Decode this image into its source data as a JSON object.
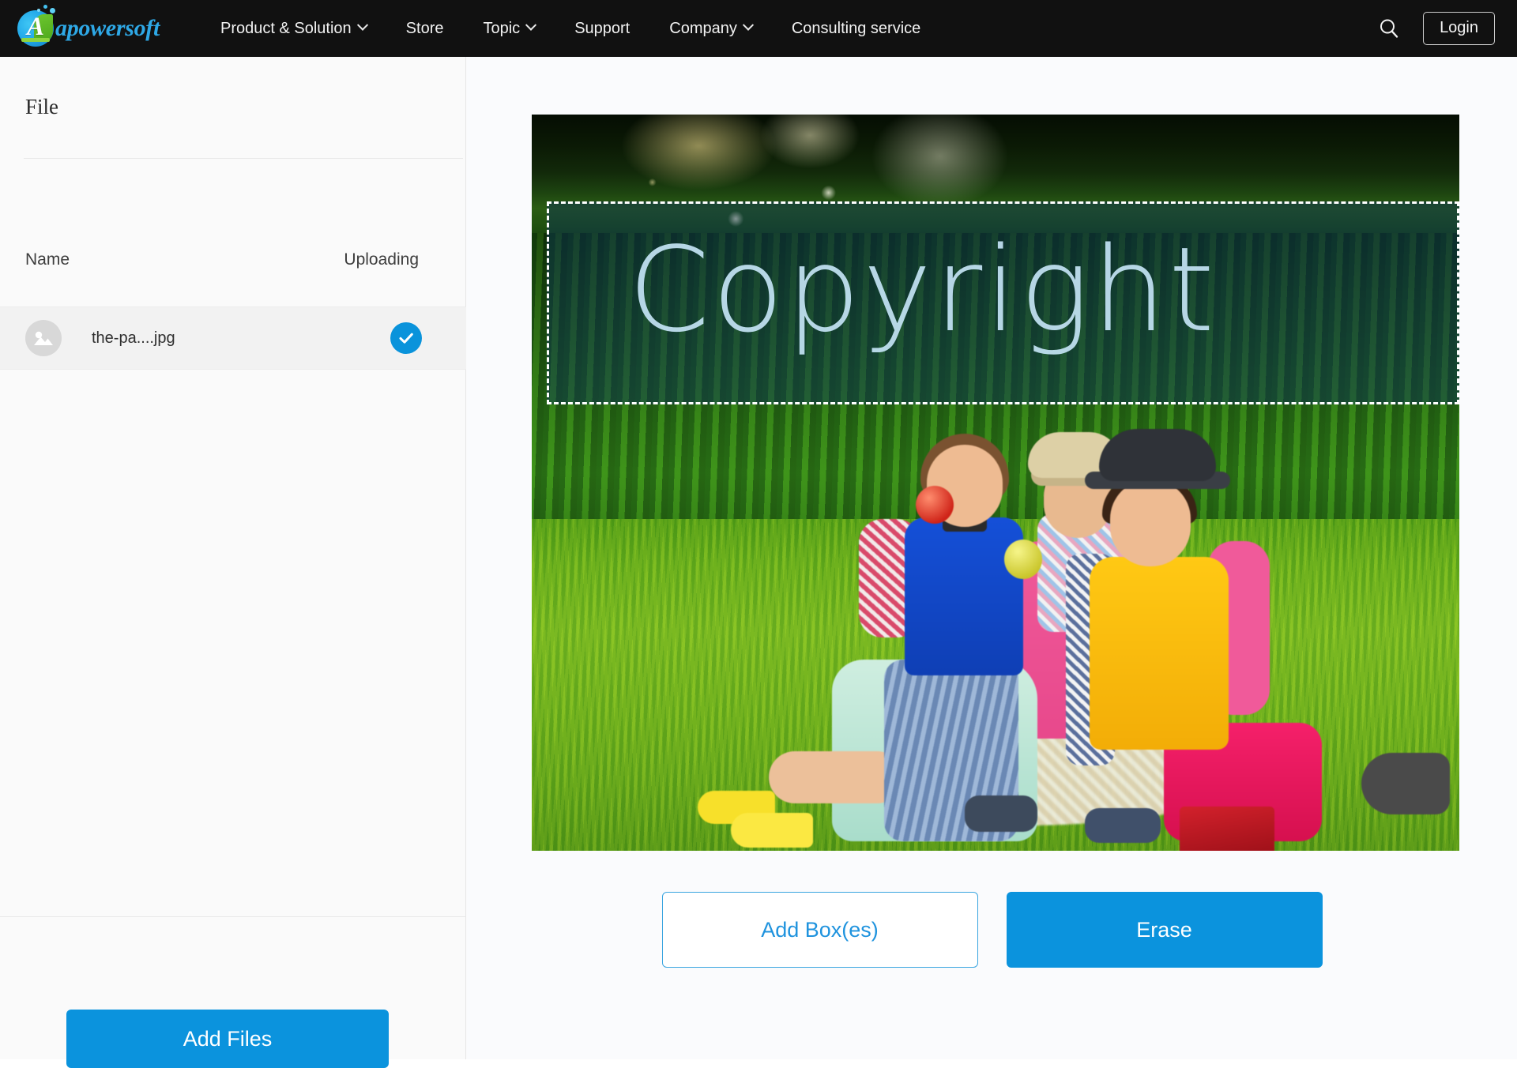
{
  "navbar": {
    "logo": {
      "letter": "A",
      "text": "apowersoft"
    },
    "links": [
      {
        "label": "Product & Solution",
        "has_caret": true
      },
      {
        "label": "Store",
        "has_caret": false
      },
      {
        "label": "Topic",
        "has_caret": true
      },
      {
        "label": "Support",
        "has_caret": false
      },
      {
        "label": "Company",
        "has_caret": true
      },
      {
        "label": "Consulting service",
        "has_caret": false
      }
    ],
    "search_icon": "search-icon",
    "login_label": "Login"
  },
  "sidebar": {
    "title": "File",
    "columns": {
      "name": "Name",
      "status": "Uploading"
    },
    "rows": [
      {
        "thumb_icon": "image-placeholder-icon",
        "name": "the-pa....jpg",
        "status_icon": "check-circle-icon"
      }
    ],
    "add_files_label": "Add Files"
  },
  "main": {
    "watermark_text": "Copyright",
    "selection": {
      "label": "selection-box"
    },
    "add_box_label": "Add Box(es)",
    "erase_label": "Erase"
  },
  "colors": {
    "accent_blue": "#0b93dd",
    "outline_blue": "#3aa5e0",
    "navbar_bg": "#111111",
    "sidebar_bg": "#fafafa",
    "selection_overlay": "rgba(10,45,92,0.42)"
  }
}
